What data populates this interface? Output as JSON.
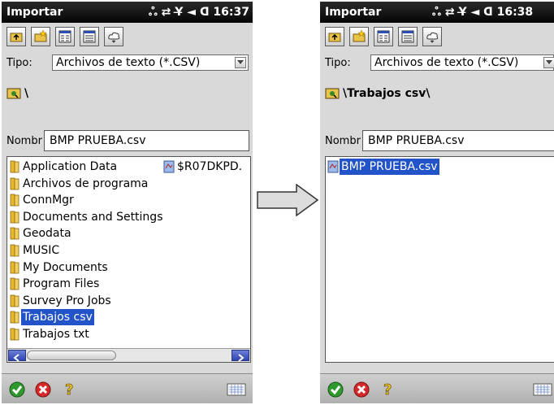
{
  "left": {
    "title": "Importar",
    "status": "ஃ ⇄ Y̶ ◄ ᗡ 16:37",
    "tipo_label": "Tipo:",
    "tipo_value": "Archivos de texto (*.CSV)",
    "path": "\\",
    "nombre_label": "Nombr",
    "nombre_value": "BMP PRUEBA.csv",
    "files": [
      {
        "name": "Application Data",
        "type": "folder"
      },
      {
        "name": "Archivos de programa",
        "type": "folder"
      },
      {
        "name": "ConnMgr",
        "type": "folder"
      },
      {
        "name": "Documents and Settings",
        "type": "folder"
      },
      {
        "name": "Geodata",
        "type": "folder"
      },
      {
        "name": "MUSIC",
        "type": "folder"
      },
      {
        "name": "My Documents",
        "type": "folder"
      },
      {
        "name": "Program Files",
        "type": "folder"
      },
      {
        "name": "Survey Pro Jobs",
        "type": "folder"
      },
      {
        "name": "Trabajos csv",
        "type": "folder",
        "selected": true
      },
      {
        "name": "Trabajos txt",
        "type": "folder"
      }
    ],
    "side_file": "$R07DKPD."
  },
  "right": {
    "title": "Importar",
    "status": "ஃ ⇄ Y̶ ◄ ᗡ 16:38",
    "tipo_label": "Tipo:",
    "tipo_value": "Archivos de texto (*.CSV)",
    "path": "\\Trabajos csv\\",
    "nombre_label": "Nombr",
    "nombre_value": "BMP PRUEBA.csv",
    "files": [
      {
        "name": "BMP PRUEBA.csv",
        "type": "file",
        "selected": true
      }
    ]
  },
  "colors": {
    "selection": "#2253c8",
    "titlebar": "#0a0a0a",
    "screen_bg": "#d9d9d9"
  },
  "icons": [
    "up-folder-icon",
    "new-folder-icon",
    "list-view-icon",
    "details-view-icon",
    "cloud-icon",
    "ok-icon",
    "cancel-icon",
    "help-icon",
    "keyboard-icon",
    "folder-icon",
    "csv-file-icon",
    "arrow-right-icon"
  ]
}
